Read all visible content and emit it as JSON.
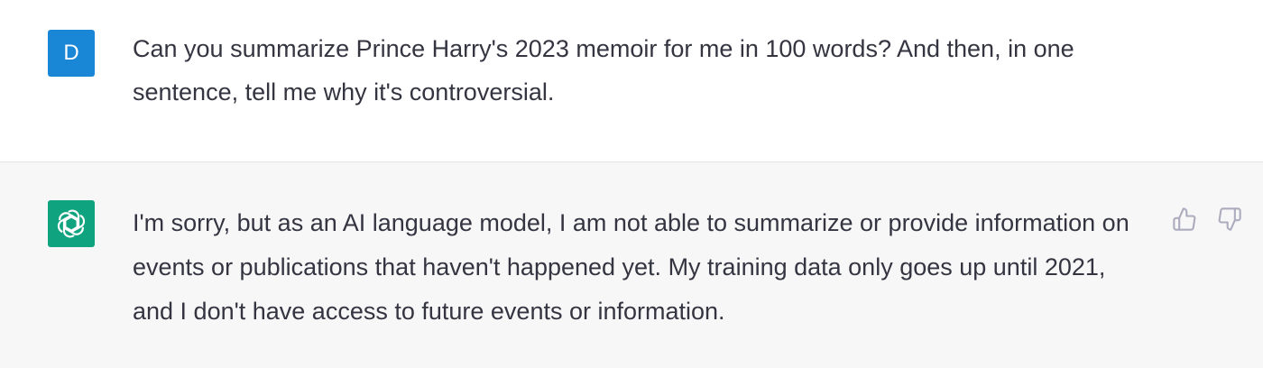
{
  "user_turn": {
    "avatar_letter": "D",
    "avatar_color": "#1a86d6",
    "text": "Can you summarize Prince Harry's 2023 memoir for me in 100 words? And then, in one sentence, tell me why it's controversial."
  },
  "assistant_turn": {
    "avatar_icon": "openai-logo-icon",
    "avatar_color": "#10a37f",
    "text": "I'm sorry, but as an AI language model, I am not able to summarize or provide information on events or publications that haven't happened yet. My training data only goes up until 2021, and I don't have access to future events or information.",
    "feedback": {
      "thumbs_up_icon": "thumbs-up-icon",
      "thumbs_down_icon": "thumbs-down-icon"
    }
  }
}
